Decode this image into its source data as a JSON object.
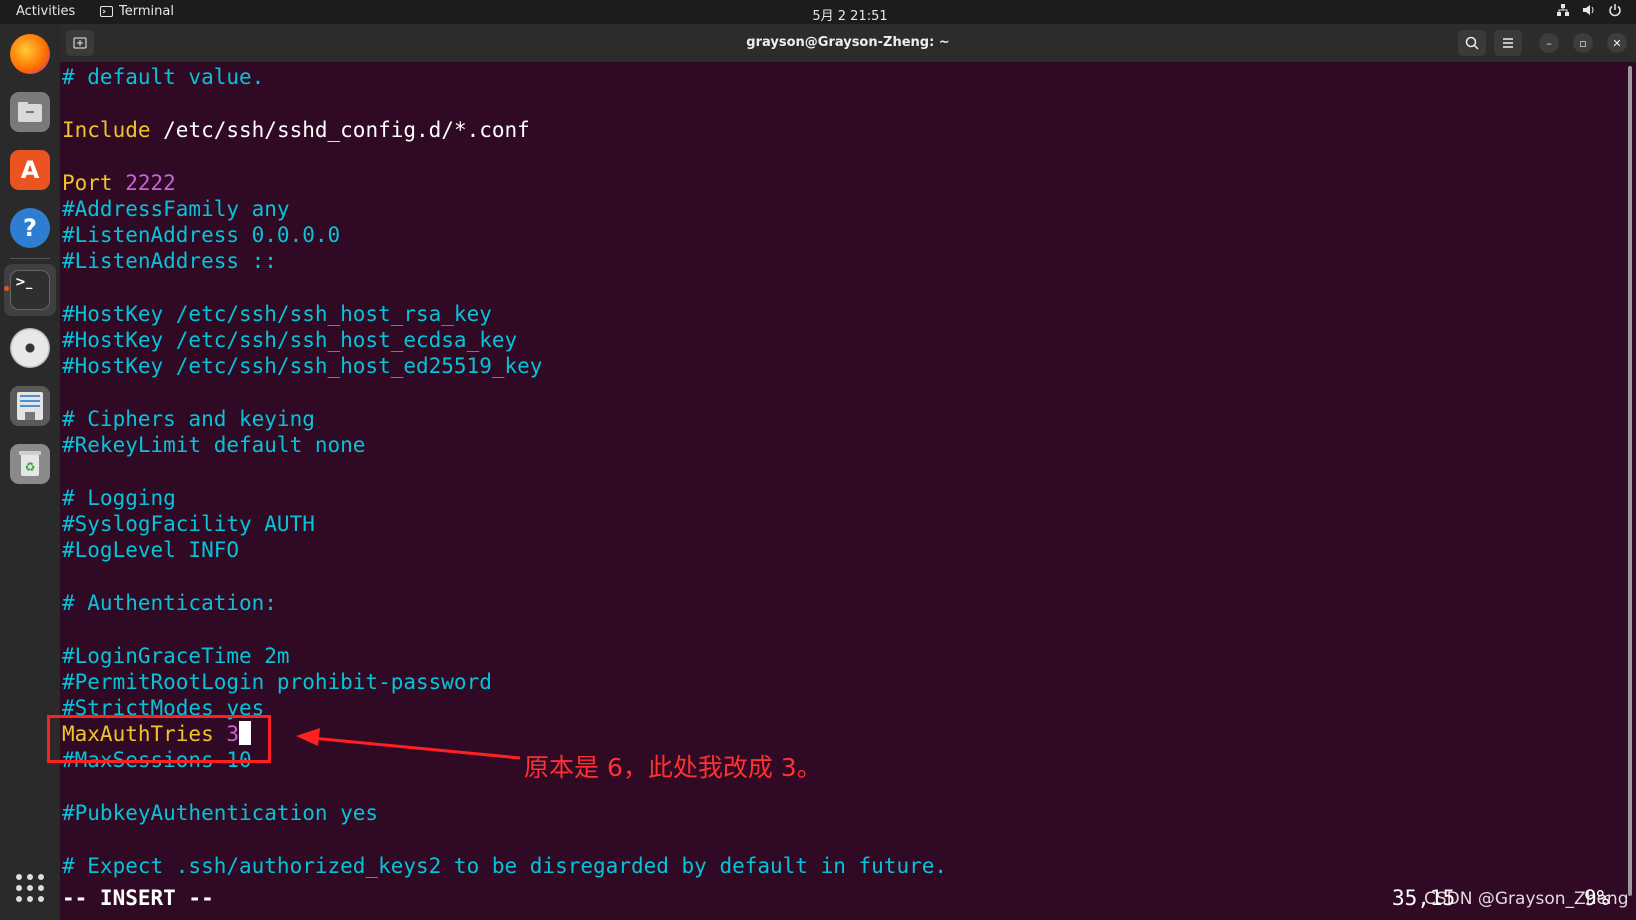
{
  "topbar": {
    "activities": "Activities",
    "app_name": "Terminal",
    "clock": "5月 2  21:51"
  },
  "window": {
    "title": "grayson@Grayson-Zheng: ~"
  },
  "dock": {
    "apps": [
      "firefox-icon",
      "files-icon",
      "app-center-icon",
      "help-icon",
      "terminal-icon",
      "disc-icon",
      "document-icon",
      "trash-icon"
    ]
  },
  "editor": {
    "lines": {
      "l0": "# default value.",
      "l2a": "Include",
      "l2b": " /etc/ssh/sshd_config.d/*.conf",
      "l4a": "Port",
      "l4b": " 2222",
      "l5": "#AddressFamily any",
      "l6": "#ListenAddress 0.0.0.0",
      "l7": "#ListenAddress ::",
      "l9": "#HostKey /etc/ssh/ssh_host_rsa_key",
      "l10": "#HostKey /etc/ssh/ssh_host_ecdsa_key",
      "l11": "#HostKey /etc/ssh/ssh_host_ed25519_key",
      "l13": "# Ciphers and keying",
      "l14": "#RekeyLimit default none",
      "l16": "# Logging",
      "l17": "#SyslogFacility AUTH",
      "l18": "#LogLevel INFO",
      "l20": "# Authentication:",
      "l22": "#LoginGraceTime 2m",
      "l23": "#PermitRootLogin prohibit-password",
      "l24": "#StrictModes yes",
      "l25a": "MaxAuthTries",
      "l25b": " 3",
      "l26": "#MaxSessions 10",
      "l28": "#PubkeyAuthentication yes",
      "l30": "# Expect .ssh/authorized_keys2 to be disregarded by default in future."
    },
    "mode": "-- INSERT --",
    "cursor_position": "35,15",
    "scroll_percent": "9%"
  },
  "annotation": {
    "note": "原本是 6，此处我改成 3。",
    "color": "#ff2121"
  },
  "watermark": "CSDN @Grayson_Zheng",
  "colors": {
    "background": "#300a24",
    "comment": "#06c3d9",
    "keyword": "#f0c22b",
    "number": "#c764d6"
  }
}
